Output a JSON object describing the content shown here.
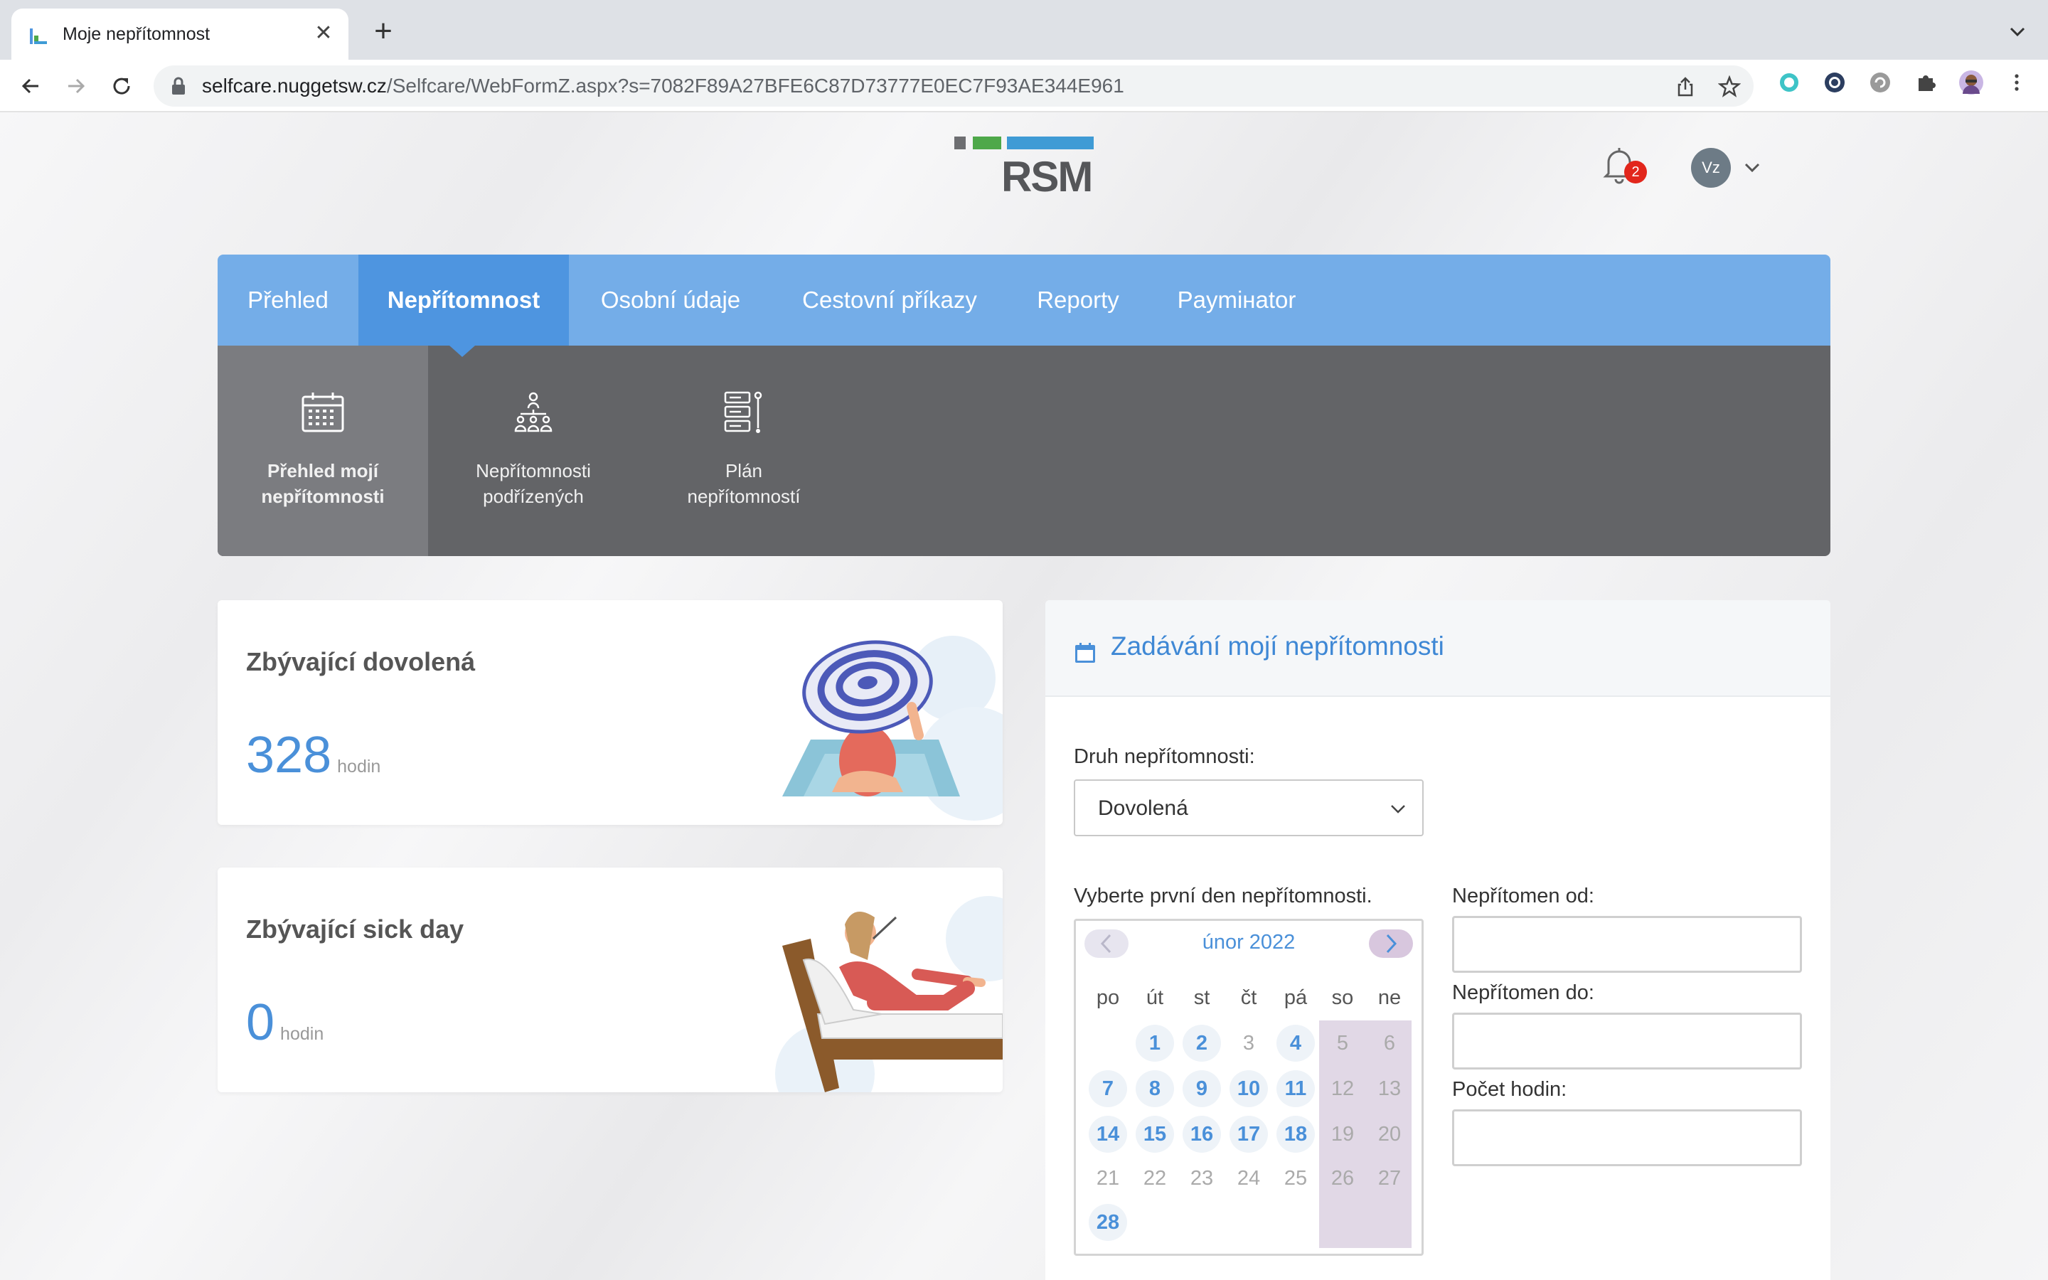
{
  "browser": {
    "tab_title": "Moje nepřítomnost",
    "url_host": "selfcare.nuggetsw.cz",
    "url_path": "/Selfcare/WebFormZ.aspx?s=7082F89A27BFE6C87D73777E0EC7F93AE344E961"
  },
  "header": {
    "logo_text": "RSM",
    "notification_count": "2",
    "avatar_initials": "Vz"
  },
  "main_nav": {
    "items": [
      {
        "label": "Přehled",
        "active": false
      },
      {
        "label": "Nepřítomnost",
        "active": true
      },
      {
        "label": "Osobní údaje",
        "active": false
      },
      {
        "label": "Cestovní příkazy",
        "active": false
      },
      {
        "label": "Reporty",
        "active": false
      },
      {
        "label": "Paymінator",
        "active": false
      }
    ]
  },
  "sub_nav": {
    "items": [
      {
        "line1": "Přehled mojí",
        "line2": "nepřítomnosti",
        "icon": "calendar-icon",
        "active": true
      },
      {
        "line1": "Nepřítomnosti",
        "line2": "podřízených",
        "icon": "org-chart-icon",
        "active": false
      },
      {
        "line1": "Plán",
        "line2": "nepřítomností",
        "icon": "server-plan-icon",
        "active": false
      }
    ]
  },
  "cards": {
    "vacation": {
      "title": "Zbývající dovolená",
      "value": "328",
      "unit": "hodin"
    },
    "sick": {
      "title": "Zbývající sick day",
      "value": "0",
      "unit": "hodin"
    }
  },
  "form": {
    "title": "Zadávání mojí nepřítomnosti",
    "type_label": "Druh nepřítomnosti:",
    "type_value": "Dovolená",
    "pick_label": "Vyberte první den nepřítomnosti.",
    "from_label": "Nepřítomen od:",
    "to_label": "Nepřítomen do:",
    "hours_label": "Počet hodin:",
    "from_value": "",
    "to_value": "",
    "hours_value": ""
  },
  "calendar": {
    "month": "únor 2022",
    "weekdays": [
      "po",
      "út",
      "st",
      "čt",
      "pá",
      "so",
      "ne"
    ],
    "days": [
      {
        "d": "1",
        "s": "avail"
      },
      {
        "d": "2",
        "s": "avail"
      },
      {
        "d": "3",
        "s": "dis"
      },
      {
        "d": "4",
        "s": "avail"
      },
      {
        "d": "5",
        "s": "dis"
      },
      {
        "d": "6",
        "s": "dis"
      },
      {
        "d": "7",
        "s": "avail"
      },
      {
        "d": "8",
        "s": "avail"
      },
      {
        "d": "9",
        "s": "avail"
      },
      {
        "d": "10",
        "s": "avail"
      },
      {
        "d": "11",
        "s": "avail"
      },
      {
        "d": "12",
        "s": "dis"
      },
      {
        "d": "13",
        "s": "dis"
      },
      {
        "d": "14",
        "s": "avail"
      },
      {
        "d": "15",
        "s": "avail"
      },
      {
        "d": "16",
        "s": "avail"
      },
      {
        "d": "17",
        "s": "avail"
      },
      {
        "d": "18",
        "s": "avail"
      },
      {
        "d": "19",
        "s": "dis"
      },
      {
        "d": "20",
        "s": "dis"
      },
      {
        "d": "21",
        "s": "dis"
      },
      {
        "d": "22",
        "s": "dis"
      },
      {
        "d": "23",
        "s": "dis"
      },
      {
        "d": "24",
        "s": "dis"
      },
      {
        "d": "25",
        "s": "dis"
      },
      {
        "d": "26",
        "s": "dis"
      },
      {
        "d": "27",
        "s": "dis"
      },
      {
        "d": "28",
        "s": "avail"
      }
    ]
  },
  "colors": {
    "nav_bg": "#74ade8",
    "nav_active": "#4e95e0",
    "subnav_bg": "#636467",
    "accent": "#4a90d9",
    "weekend": "#e1d8e6"
  }
}
